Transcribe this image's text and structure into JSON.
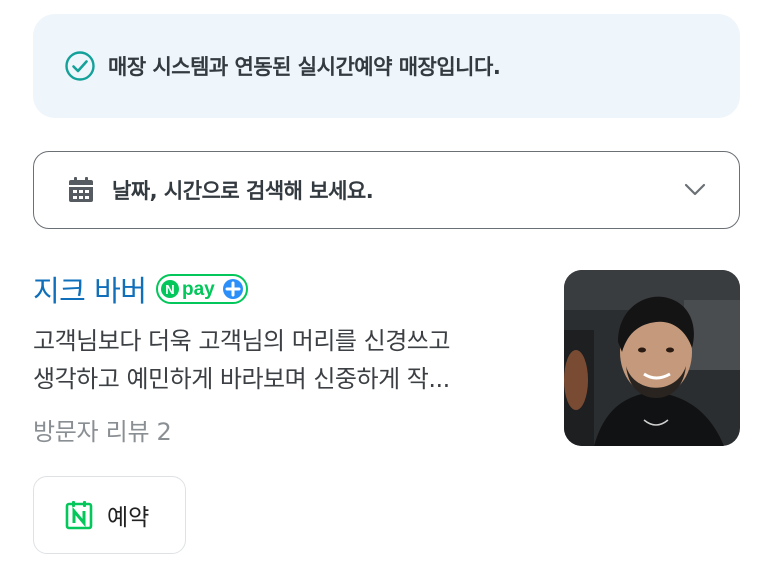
{
  "notice": {
    "icon": "check-circle-icon",
    "text": "매장 시스템과 연동된 실시간예약 매장입니다."
  },
  "date_picker": {
    "icon": "calendar-icon",
    "placeholder": "날짜, 시간으로 검색해 보세요.",
    "chevron": "chevron-down-icon"
  },
  "store": {
    "name": "지크 바버",
    "badge": "Npay+",
    "description_line1": "고객님보다 더욱 고객님의 머리를 신경쓰고",
    "description_line2": "생각하고 예민하게 바라보며 신중하게 작...",
    "reviews": "방문자 리뷰 2",
    "photo": "barber-profile-photo"
  },
  "booking": {
    "icon": "naver-booking-icon",
    "label": "예약"
  },
  "colors": {
    "accent_blue": "#0f6fba",
    "notice_bg": "#eef5fb",
    "check_teal": "#14a19a",
    "npay_green": "#03c75a",
    "npay_blue": "#2c8ef8"
  }
}
